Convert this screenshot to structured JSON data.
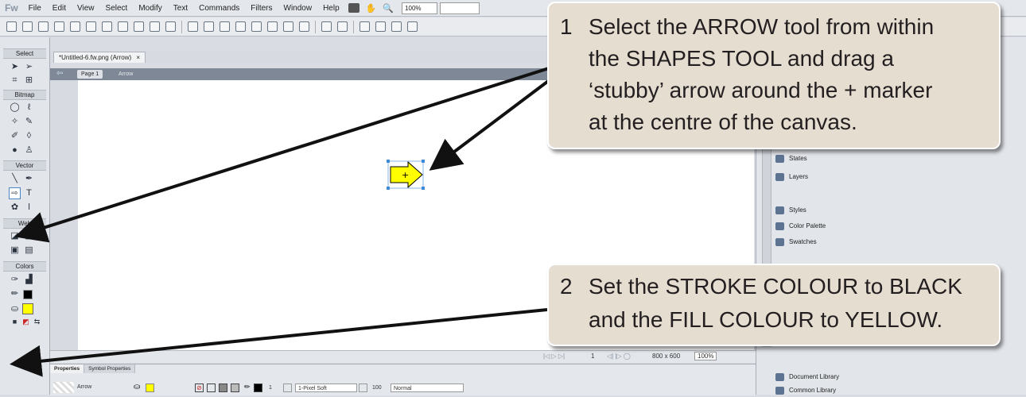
{
  "menubar": {
    "logo": "Fw",
    "items": [
      "File",
      "Edit",
      "View",
      "Select",
      "Modify",
      "Text",
      "Commands",
      "Filters",
      "Window",
      "Help"
    ],
    "zoom": "100%"
  },
  "tools": {
    "sections": [
      "Select",
      "Bitmap",
      "Vector",
      "Web",
      "Colors"
    ]
  },
  "document": {
    "tab_label": "*Untitled-6.fw.png (Arrow)",
    "tab_close": "×",
    "page_label": "Page 1",
    "object_label": "Arrow"
  },
  "statusbar": {
    "frame": "1",
    "size": "800 x 600",
    "zoom": "100%"
  },
  "right_panel": {
    "items": [
      "States",
      "Layers",
      "Styles",
      "Color Palette",
      "Swatches",
      "Document Library",
      "Common Library"
    ]
  },
  "properties": {
    "tabs": [
      "Properties",
      "Symbol Properties"
    ],
    "object_name": "Arrow",
    "stroke_width": "1",
    "stroke_type": "1-Pixel Soft",
    "opacity": "100",
    "blend_mode": "Normal"
  },
  "colors": {
    "stroke": "#000000",
    "fill": "#ffff00",
    "callout_bg": "#e6ddd1",
    "pointer_arrow": "#111111"
  },
  "callouts": [
    {
      "number": "1",
      "lines": [
        "Select the ARROW tool from within",
        "the SHAPES TOOL and drag a",
        "‘stubby’ arrow around the + marker",
        "at the centre of the canvas."
      ]
    },
    {
      "number": "2",
      "lines": [
        "Set the STROKE COLOUR to BLACK",
        "and the FILL COLOUR to YELLOW."
      ]
    }
  ]
}
